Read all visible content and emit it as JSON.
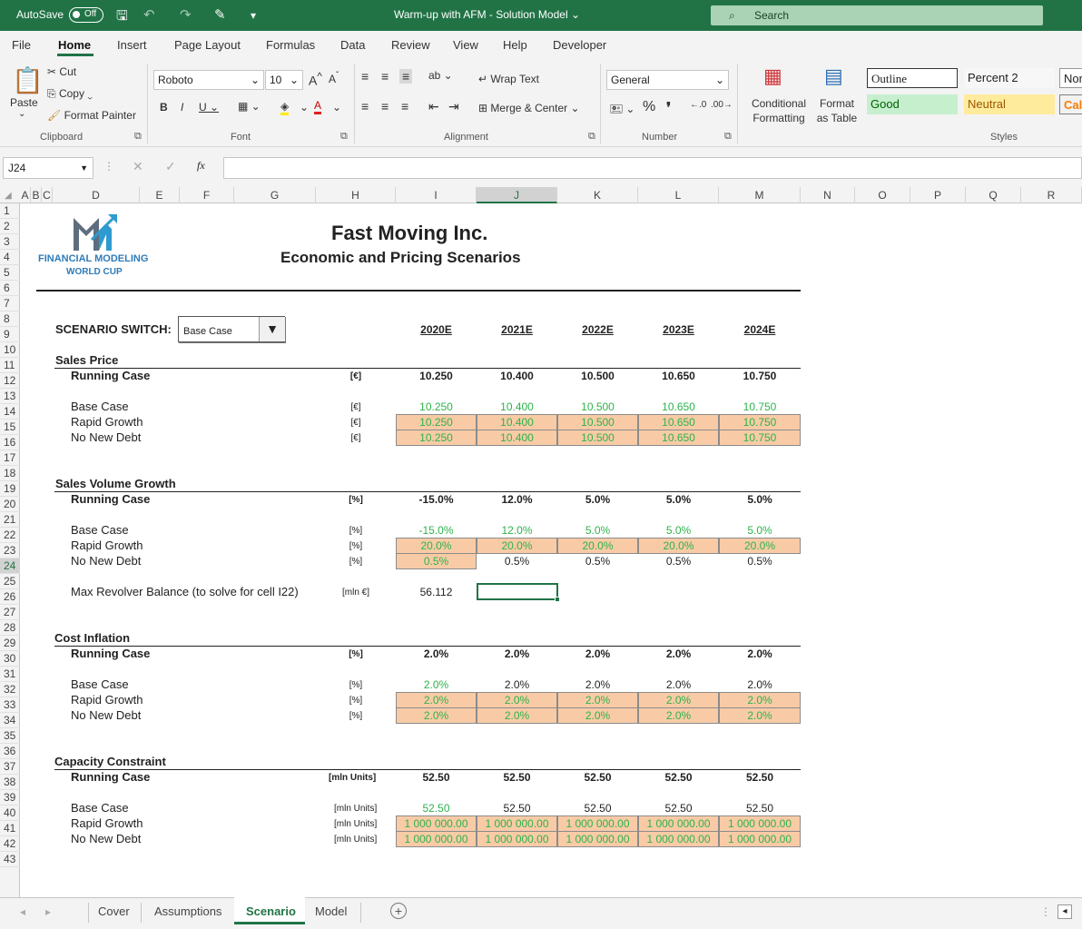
{
  "titlebar": {
    "autosave_label": "AutoSave",
    "autosave_state": "Off",
    "doc_title": "Warm-up with AFM - Solution Model",
    "search_placeholder": "Search"
  },
  "menu": [
    "File",
    "Home",
    "Insert",
    "Page Layout",
    "Formulas",
    "Data",
    "Review",
    "View",
    "Help",
    "Developer"
  ],
  "ribbon": {
    "clipboard": {
      "paste": "Paste",
      "cut": "Cut",
      "copy": "Copy",
      "format_painter": "Format Painter",
      "label": "Clipboard"
    },
    "font": {
      "name": "Roboto",
      "size": "10",
      "label": "Font"
    },
    "alignment": {
      "wrap_text": "Wrap Text",
      "merge_center": "Merge & Center",
      "label": "Alignment"
    },
    "number": {
      "format": "General",
      "label": "Number"
    },
    "styles": {
      "conditional_formatting": "Conditional Formatting",
      "format_as_table": "Format as Table",
      "outline": "Outline",
      "percent2": "Percent 2",
      "normal": "Nor",
      "good": "Good",
      "neutral": "Neutral",
      "calc": "Calc",
      "label": "Styles"
    }
  },
  "formula_bar": {
    "name_box": "J24",
    "formula": ""
  },
  "columns": [
    "A",
    "B",
    "C",
    "D",
    "E",
    "F",
    "G",
    "H",
    "I",
    "J",
    "K",
    "L",
    "M",
    "N",
    "O",
    "P",
    "Q",
    "R"
  ],
  "selected_column": "J",
  "selected_row": "24",
  "rows": [
    "1",
    "2",
    "3",
    "4",
    "5",
    "6",
    "7",
    "8",
    "9",
    "10",
    "11",
    "12",
    "13",
    "14",
    "15",
    "16",
    "17",
    "18",
    "19",
    "20",
    "21",
    "22",
    "23",
    "24",
    "25",
    "26",
    "27",
    "28",
    "29",
    "30",
    "31",
    "32",
    "33",
    "34",
    "35",
    "36",
    "37",
    "38",
    "39",
    "40",
    "41",
    "42",
    "43"
  ],
  "logo": {
    "line1": "FINANCIAL MODELING",
    "line2": "WORLD CUP"
  },
  "sheet": {
    "title": "Fast Moving Inc.",
    "subtitle": "Economic and Pricing Scenarios",
    "scenario_label": "SCENARIO SWITCH:",
    "scenario_value": "Base Case",
    "years": [
      "2020E",
      "2021E",
      "2022E",
      "2023E",
      "2024E"
    ],
    "sales_price": {
      "header": "Sales Price",
      "running": {
        "label": "Running Case",
        "unit": "[€]",
        "values": [
          "10.250",
          "10.400",
          "10.500",
          "10.650",
          "10.750"
        ]
      },
      "base": {
        "label": "Base Case",
        "unit": "[€]",
        "values": [
          "10.250",
          "10.400",
          "10.500",
          "10.650",
          "10.750"
        ]
      },
      "rapid": {
        "label": "Rapid Growth",
        "unit": "[€]",
        "values": [
          "10.250",
          "10.400",
          "10.500",
          "10.650",
          "10.750"
        ]
      },
      "nodebt": {
        "label": "No New Debt",
        "unit": "[€]",
        "values": [
          "10.250",
          "10.400",
          "10.500",
          "10.650",
          "10.750"
        ]
      }
    },
    "sales_volume": {
      "header": "Sales Volume Growth",
      "running": {
        "label": "Running Case",
        "unit": "[%]",
        "values": [
          "-15.0%",
          "12.0%",
          "5.0%",
          "5.0%",
          "5.0%"
        ]
      },
      "base": {
        "label": "Base Case",
        "unit": "[%]",
        "values": [
          "-15.0%",
          "12.0%",
          "5.0%",
          "5.0%",
          "5.0%"
        ]
      },
      "rapid": {
        "label": "Rapid Growth",
        "unit": "[%]",
        "values": [
          "20.0%",
          "20.0%",
          "20.0%",
          "20.0%",
          "20.0%"
        ]
      },
      "nodebt": {
        "label": "No New Debt",
        "unit": "[%]",
        "values": [
          "0.5%",
          "0.5%",
          "0.5%",
          "0.5%",
          "0.5%"
        ]
      }
    },
    "max_revolver": {
      "label": "Max Revolver Balance (to solve for cell I22)",
      "unit": "[mln €]",
      "value": "56.112"
    },
    "cost_inflation": {
      "header": "Cost Inflation",
      "running": {
        "label": "Running Case",
        "unit": "[%]",
        "values": [
          "2.0%",
          "2.0%",
          "2.0%",
          "2.0%",
          "2.0%"
        ]
      },
      "base": {
        "label": "Base Case",
        "unit": "[%]",
        "values": [
          "2.0%",
          "2.0%",
          "2.0%",
          "2.0%",
          "2.0%"
        ]
      },
      "rapid": {
        "label": "Rapid Growth",
        "unit": "[%]",
        "values": [
          "2.0%",
          "2.0%",
          "2.0%",
          "2.0%",
          "2.0%"
        ]
      },
      "nodebt": {
        "label": "No New Debt",
        "unit": "[%]",
        "values": [
          "2.0%",
          "2.0%",
          "2.0%",
          "2.0%",
          "2.0%"
        ]
      }
    },
    "capacity": {
      "header": "Capacity Constraint",
      "running": {
        "label": "Running Case",
        "unit": "[mln Units]",
        "values": [
          "52.50",
          "52.50",
          "52.50",
          "52.50",
          "52.50"
        ]
      },
      "base": {
        "label": "Base Case",
        "unit": "[mln Units]",
        "values": [
          "52.50",
          "52.50",
          "52.50",
          "52.50",
          "52.50"
        ]
      },
      "rapid": {
        "label": "Rapid Growth",
        "unit": "[mln Units]",
        "values": [
          "1 000 000.00",
          "1 000 000.00",
          "1 000 000.00",
          "1 000 000.00",
          "1 000 000.00"
        ]
      },
      "nodebt": {
        "label": "No New Debt",
        "unit": "[mln Units]",
        "values": [
          "1 000 000.00",
          "1 000 000.00",
          "1 000 000.00",
          "1 000 000.00",
          "1 000 000.00"
        ]
      }
    }
  },
  "tabs": [
    "Cover",
    "Assumptions",
    "Scenario",
    "Model"
  ],
  "active_tab": "Scenario",
  "colors": {
    "excel_green": "#217346",
    "input_orange": "#f8cba6",
    "link_green": "#2db34a"
  }
}
